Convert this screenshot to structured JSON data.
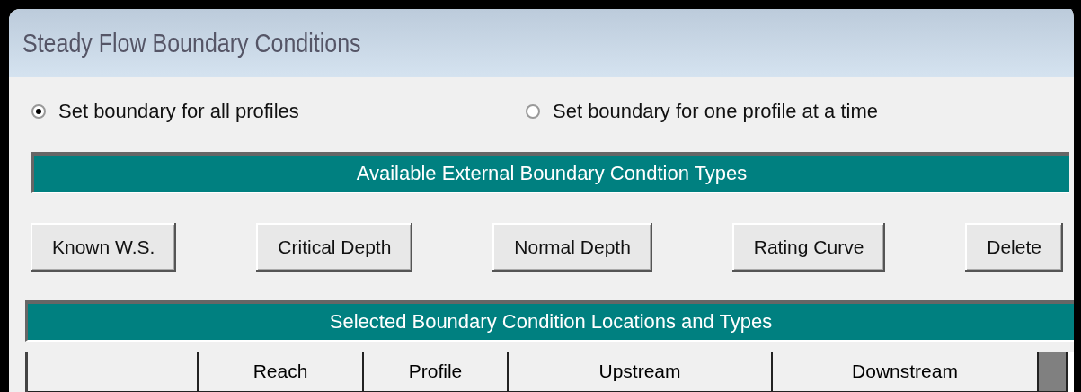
{
  "window": {
    "title": "Steady Flow Boundary Conditions"
  },
  "mode_options": [
    {
      "label": "Set boundary for all profiles",
      "selected": true
    },
    {
      "label": "Set boundary for one profile at a time",
      "selected": false
    }
  ],
  "types_header": "Available External Boundary Condtion Types",
  "type_buttons": [
    "Known W.S.",
    "Critical Depth",
    "Normal Depth",
    "Rating Curve",
    "Delete"
  ],
  "locations_header": "Selected Boundary Condition Locations and Types",
  "table": {
    "columns": [
      "Reach",
      "Profile",
      "Upstream",
      "Downstream"
    ]
  }
}
